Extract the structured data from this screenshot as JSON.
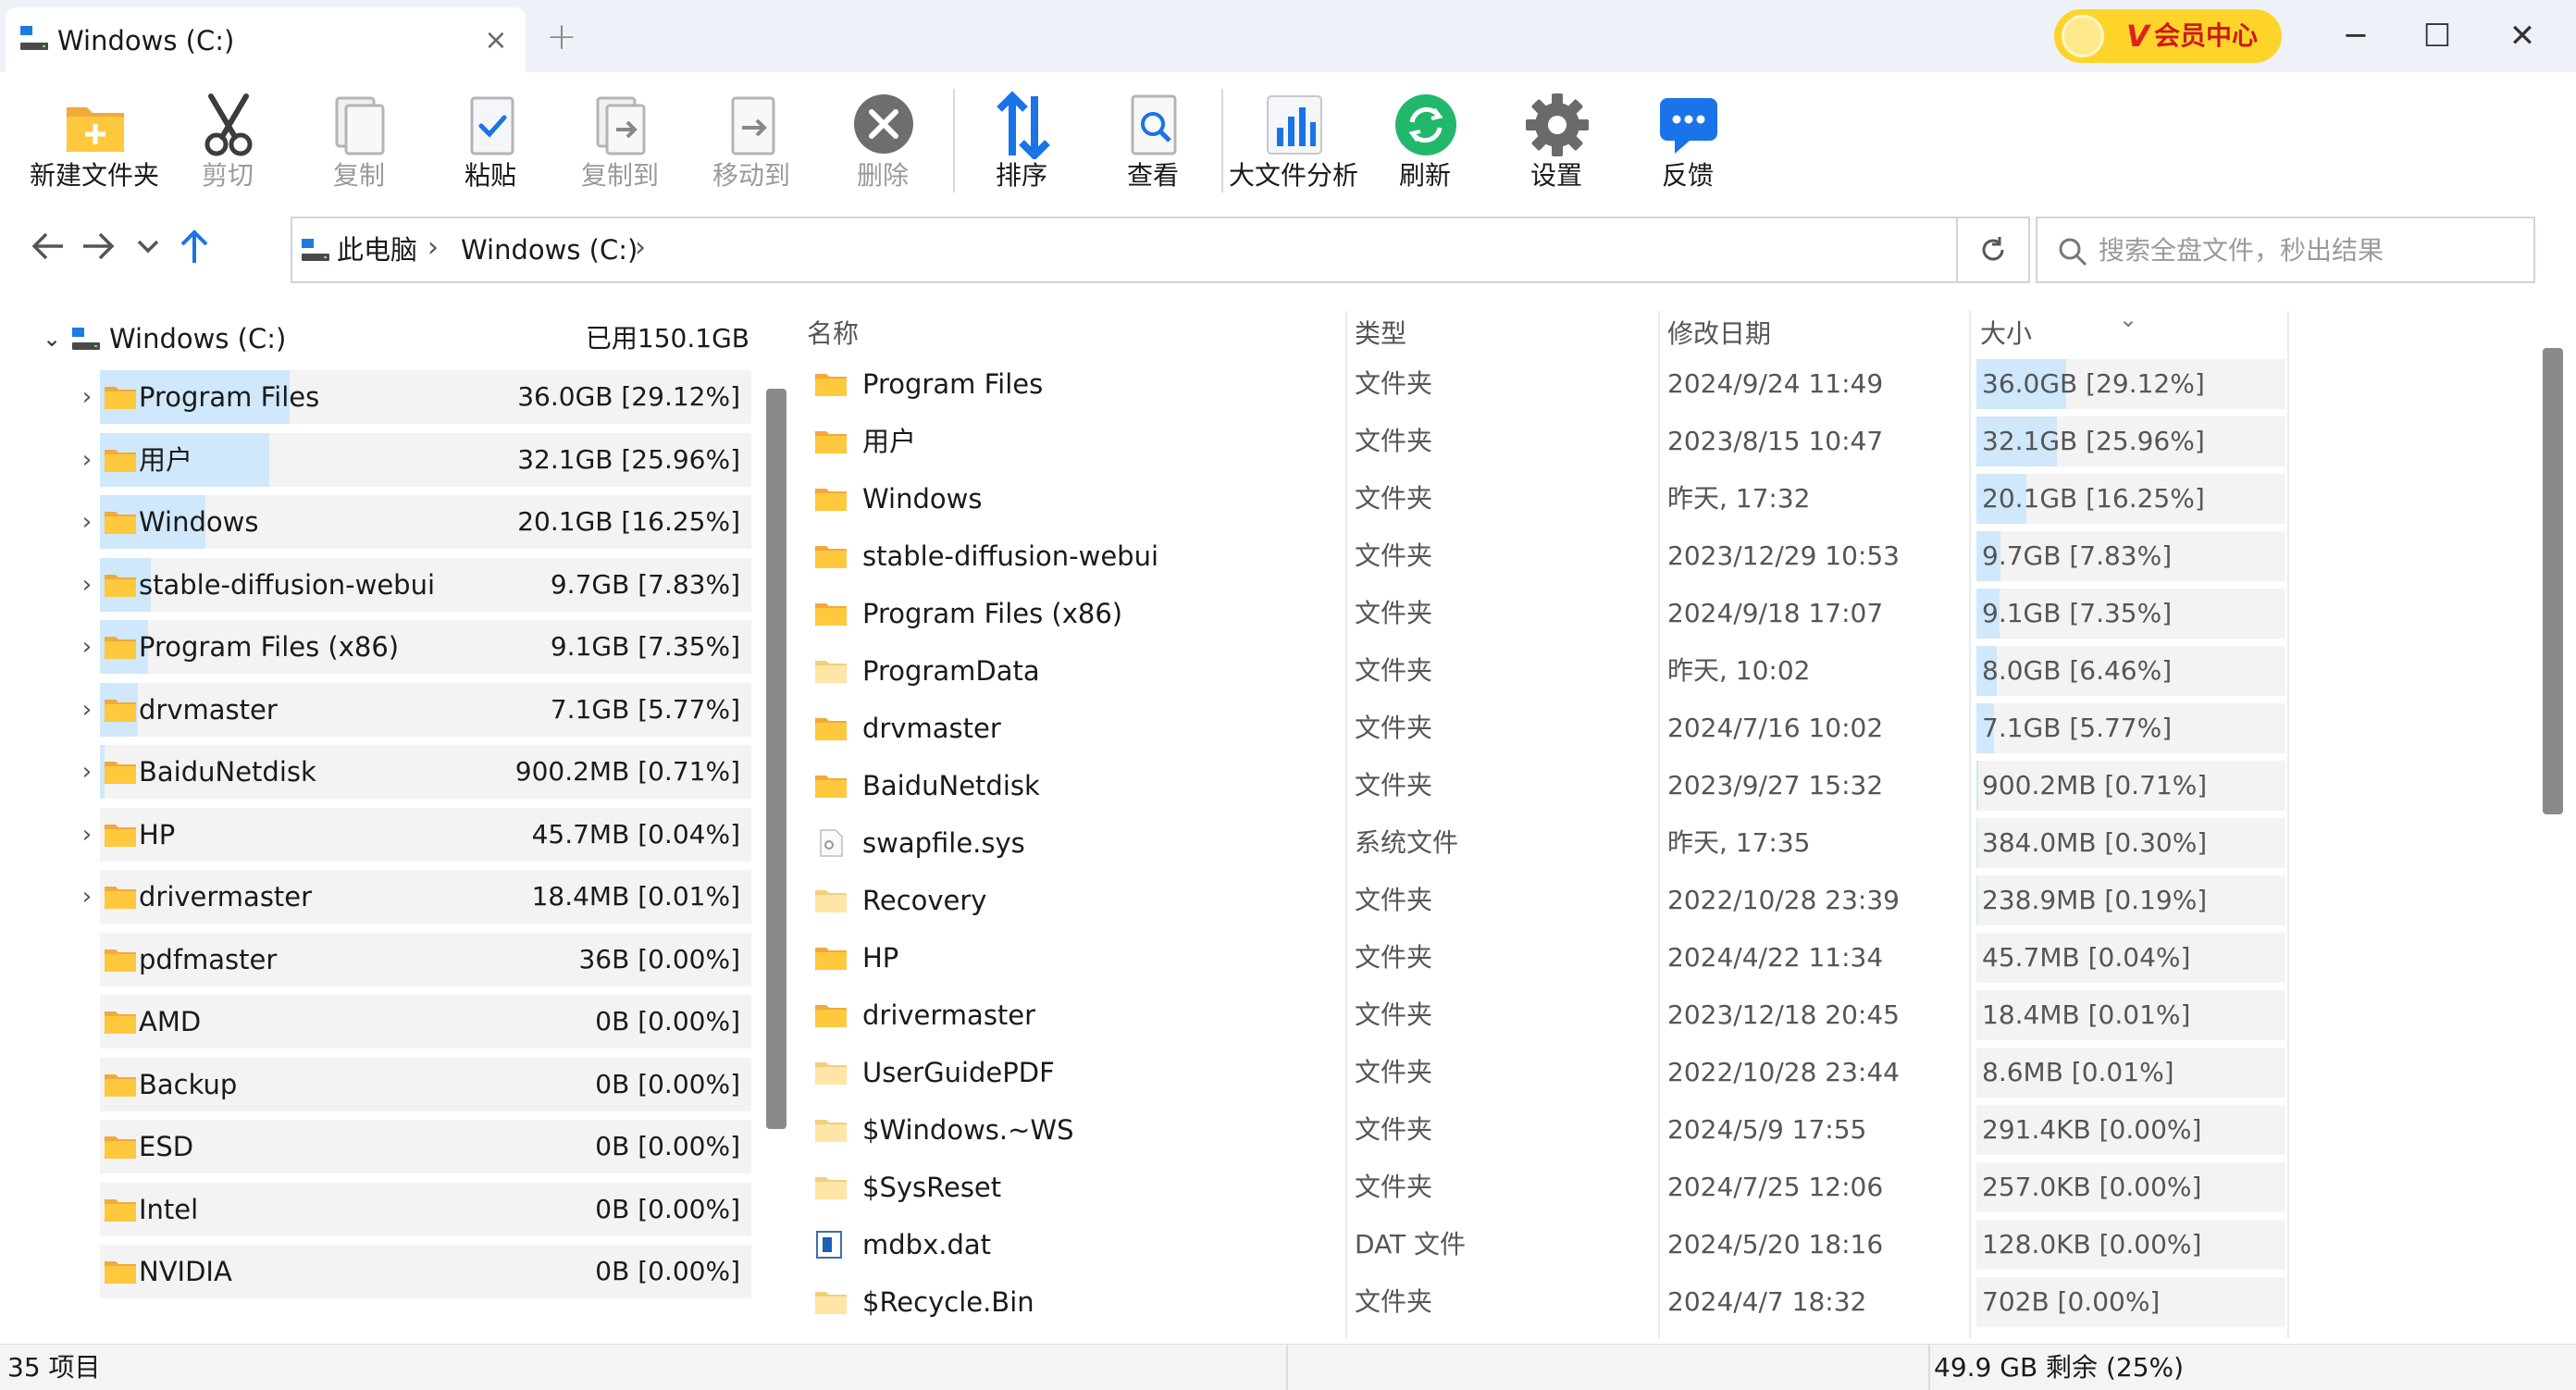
{
  "window": {
    "tab_title": "Windows (C:)",
    "tab_close": "×",
    "new_tab": "+",
    "vip_mark": "V",
    "vip_label": "会员中心",
    "min": "─",
    "max": "☐",
    "close": "✕"
  },
  "toolbar": {
    "new_folder": "新建文件夹",
    "cut": "剪切",
    "copy": "复制",
    "paste": "粘贴",
    "copy_to": "复制到",
    "move_to": "移动到",
    "delete": "删除",
    "sort": "排序",
    "view": "查看",
    "big_file_analysis": "大文件分析",
    "refresh": "刷新",
    "settings": "设置",
    "feedback": "反馈"
  },
  "address": {
    "crumbs": [
      "此电脑",
      "Windows (C:)"
    ],
    "sep": "›",
    "search_placeholder": "搜索全盘文件，秒出结果"
  },
  "tree": {
    "root_label": "Windows (C:)",
    "root_used": "已用150.1GB",
    "root_chevron": "⌄",
    "items": [
      {
        "name": "Program Files",
        "size": "36.0GB [29.12%]",
        "expand": "›",
        "pct": 29.12
      },
      {
        "name": "用户",
        "size": "32.1GB [25.96%]",
        "expand": "›",
        "pct": 25.96
      },
      {
        "name": "Windows",
        "size": "20.1GB [16.25%]",
        "expand": "›",
        "pct": 16.25
      },
      {
        "name": "stable-diffusion-webui",
        "size": "9.7GB [7.83%]",
        "expand": "›",
        "pct": 7.83
      },
      {
        "name": "Program Files (x86)",
        "size": "9.1GB [7.35%]",
        "expand": "›",
        "pct": 7.35
      },
      {
        "name": "drvmaster",
        "size": "7.1GB [5.77%]",
        "expand": "›",
        "pct": 5.77
      },
      {
        "name": "BaiduNetdisk",
        "size": "900.2MB [0.71%]",
        "expand": "›",
        "pct": 0.71
      },
      {
        "name": "HP",
        "size": "45.7MB [0.04%]",
        "expand": "›",
        "pct": 0.04
      },
      {
        "name": "drivermaster",
        "size": "18.4MB [0.01%]",
        "expand": "›",
        "pct": 0.01
      },
      {
        "name": "pdfmaster",
        "size": "36B [0.00%]",
        "expand": "",
        "pct": 0
      },
      {
        "name": "AMD",
        "size": "0B [0.00%]",
        "expand": "",
        "pct": 0
      },
      {
        "name": "Backup",
        "size": "0B [0.00%]",
        "expand": "",
        "pct": 0
      },
      {
        "name": "ESD",
        "size": "0B [0.00%]",
        "expand": "",
        "pct": 0
      },
      {
        "name": "Intel",
        "size": "0B [0.00%]",
        "expand": "",
        "pct": 0
      },
      {
        "name": "NVIDIA",
        "size": "0B [0.00%]",
        "expand": "",
        "pct": 0
      }
    ]
  },
  "list": {
    "headers": {
      "name": "名称",
      "type": "类型",
      "date": "修改日期",
      "size": "大小"
    },
    "sort_indicator": "⌄",
    "rows": [
      {
        "name": "Program Files",
        "type": "文件夹",
        "date": "2024/9/24 11:49",
        "size": "36.0GB [29.12%]",
        "pct": 29.12,
        "icon": "folder-icon"
      },
      {
        "name": "用户",
        "type": "文件夹",
        "date": "2023/8/15 10:47",
        "size": "32.1GB [25.96%]",
        "pct": 25.96,
        "icon": "folder-icon"
      },
      {
        "name": "Windows",
        "type": "文件夹",
        "date": "昨天, 17:32",
        "size": "20.1GB [16.25%]",
        "pct": 16.25,
        "icon": "folder-icon"
      },
      {
        "name": "stable-diffusion-webui",
        "type": "文件夹",
        "date": "2023/12/29 10:53",
        "size": "9.7GB [7.83%]",
        "pct": 7.83,
        "icon": "folder-icon"
      },
      {
        "name": "Program Files (x86)",
        "type": "文件夹",
        "date": "2024/9/18 17:07",
        "size": "9.1GB [7.35%]",
        "pct": 7.35,
        "icon": "folder-icon"
      },
      {
        "name": "ProgramData",
        "type": "文件夹",
        "date": "昨天, 10:02",
        "size": "8.0GB [6.46%]",
        "pct": 6.46,
        "icon": "folder-hidden-icon"
      },
      {
        "name": "drvmaster",
        "type": "文件夹",
        "date": "2024/7/16 10:02",
        "size": "7.1GB [5.77%]",
        "pct": 5.77,
        "icon": "folder-icon"
      },
      {
        "name": "BaiduNetdisk",
        "type": "文件夹",
        "date": "2023/9/27 15:32",
        "size": "900.2MB [0.71%]",
        "pct": 0.71,
        "icon": "folder-icon"
      },
      {
        "name": "swapfile.sys",
        "type": "系统文件",
        "date": "昨天, 17:35",
        "size": "384.0MB [0.30%]",
        "pct": 0.3,
        "icon": "system-file-icon"
      },
      {
        "name": "Recovery",
        "type": "文件夹",
        "date": "2022/10/28 23:39",
        "size": "238.9MB [0.19%]",
        "pct": 0.19,
        "icon": "folder-hidden-icon"
      },
      {
        "name": "HP",
        "type": "文件夹",
        "date": "2024/4/22 11:34",
        "size": "45.7MB [0.04%]",
        "pct": 0.04,
        "icon": "folder-icon"
      },
      {
        "name": "drivermaster",
        "type": "文件夹",
        "date": "2023/12/18 20:45",
        "size": "18.4MB [0.01%]",
        "pct": 0.01,
        "icon": "folder-icon"
      },
      {
        "name": "UserGuidePDF",
        "type": "文件夹",
        "date": "2022/10/28 23:44",
        "size": "8.6MB [0.01%]",
        "pct": 0.01,
        "icon": "folder-hidden-icon"
      },
      {
        "name": "$Windows.~WS",
        "type": "文件夹",
        "date": "2024/5/9 17:55",
        "size": "291.4KB [0.00%]",
        "pct": 0,
        "icon": "folder-hidden-icon"
      },
      {
        "name": "$SysReset",
        "type": "文件夹",
        "date": "2024/7/25 12:06",
        "size": "257.0KB [0.00%]",
        "pct": 0,
        "icon": "folder-hidden-icon"
      },
      {
        "name": "mdbx.dat",
        "type": "DAT 文件",
        "date": "2024/5/20 18:16",
        "size": "128.0KB [0.00%]",
        "pct": 0,
        "icon": "dat-file-icon"
      },
      {
        "name": "$Recycle.Bin",
        "type": "文件夹",
        "date": "2024/4/7 18:32",
        "size": "702B [0.00%]",
        "pct": 0,
        "icon": "folder-hidden-icon"
      }
    ]
  },
  "status": {
    "item_count": "35 项目",
    "free_space": "49.9 GB 剩余 (25%)"
  },
  "colors": {
    "accent": "#1a73e8",
    "size_bar": "#cfe8fb",
    "folder": "#ffc83d",
    "vip": "#ffd42a"
  }
}
